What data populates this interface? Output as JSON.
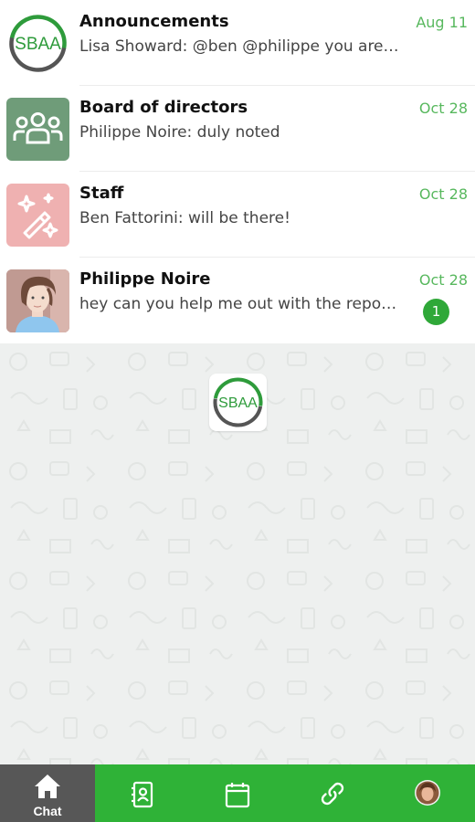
{
  "chats": [
    {
      "title": "Announcements",
      "preview": "Lisa Showard: @ben @philippe you are needed",
      "date": "Aug 11",
      "avatar_icon": "sbaa-logo-icon"
    },
    {
      "title": "Board of directors",
      "preview": "Philippe Noire: duly noted",
      "date": "Oct 28",
      "avatar_icon": "group-icon"
    },
    {
      "title": "Staff",
      "preview": "Ben Fattorini: will be there!",
      "date": "Oct 28",
      "avatar_icon": "magic-wand-icon"
    },
    {
      "title": "Philippe Noire",
      "preview": "hey can you help me out with the report?",
      "date": "Oct 28",
      "unread": "1",
      "avatar_icon": "person-photo"
    }
  ],
  "logo": {
    "text": "SBAA"
  },
  "bottom_nav": {
    "tabs": [
      {
        "label": "Chat",
        "icon": "home-icon",
        "active": true
      },
      {
        "label": "",
        "icon": "contacts-icon"
      },
      {
        "label": "",
        "icon": "calendar-icon"
      },
      {
        "label": "",
        "icon": "link-icon"
      },
      {
        "label": "",
        "icon": "profile-avatar-icon"
      }
    ]
  },
  "colors": {
    "accent_green": "#2fb237",
    "date_green": "#58b85e",
    "badge_green": "#2fa838",
    "active_tab": "#575757",
    "board_avatar_bg": "#6f9c79",
    "staff_avatar_bg": "#efb1b1"
  }
}
